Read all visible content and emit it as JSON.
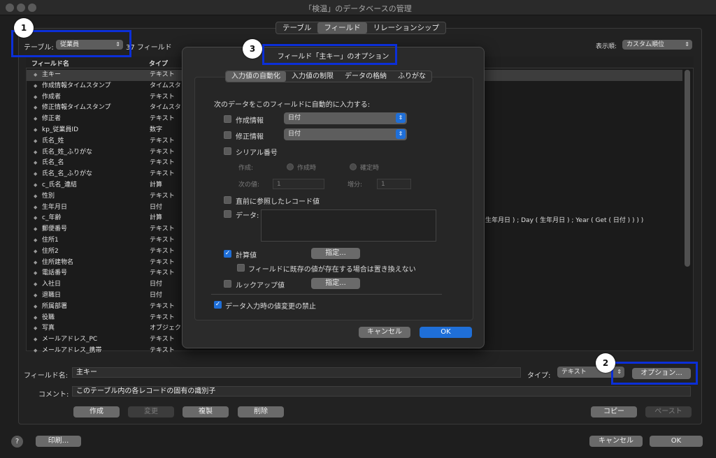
{
  "window": {
    "title": "「検温」のデータベースの管理"
  },
  "main_tabs": [
    {
      "label": "テーブル"
    },
    {
      "label": "フィールド"
    },
    {
      "label": "リレーションシップ"
    }
  ],
  "toolbar": {
    "table_label": "テーブル:",
    "table_value": "従業員",
    "field_count": "37 フィールド",
    "sort_label": "表示順:",
    "sort_value": "カスタム順位"
  },
  "columns": {
    "name": "フィールド名",
    "type": "タイプ"
  },
  "fields": [
    {
      "name": "主キー",
      "type": "テキスト"
    },
    {
      "name": "作成情報タイムスタンプ",
      "type": "タイムスタンプ"
    },
    {
      "name": "作成者",
      "type": "テキスト"
    },
    {
      "name": "修正情報タイムスタンプ",
      "type": "タイムスタンプ"
    },
    {
      "name": "修正者",
      "type": "テキスト"
    },
    {
      "name": "kp_従業員ID",
      "type": "数字"
    },
    {
      "name": "氏名_姓",
      "type": "テキスト"
    },
    {
      "name": "氏名_姓_ふりがな",
      "type": "テキスト"
    },
    {
      "name": "氏名_名",
      "type": "テキスト"
    },
    {
      "name": "氏名_名_ふりがな",
      "type": "テキスト"
    },
    {
      "name": "c_氏名_連結",
      "type": "計算"
    },
    {
      "name": "性別",
      "type": "テキスト"
    },
    {
      "name": "生年月日",
      "type": "日付"
    },
    {
      "name": "c_年齢",
      "type": "計算"
    },
    {
      "name": "郵便番号",
      "type": "テキスト"
    },
    {
      "name": "住所1",
      "type": "テキスト"
    },
    {
      "name": "住所2",
      "type": "テキスト"
    },
    {
      "name": "住所建物名",
      "type": "テキスト"
    },
    {
      "name": "電話番号",
      "type": "テキスト"
    },
    {
      "name": "入社日",
      "type": "日付"
    },
    {
      "name": "退職日",
      "type": "日付"
    },
    {
      "name": "所属部署",
      "type": "テキスト"
    },
    {
      "name": "役職",
      "type": "テキスト"
    },
    {
      "name": "写真",
      "type": "オブジェクト"
    },
    {
      "name": "メールアドレス_PC",
      "type": "テキスト"
    },
    {
      "name": "メールアドレス_携帯",
      "type": "テキスト"
    }
  ],
  "formula_fragment": "生年月日 ) ; Day ( 生年月日 ) ; Year ( Get ( 日付 ) ) ) )",
  "editor": {
    "name_label": "フィールド名:",
    "name_value": "主キー",
    "type_label": "タイプ:",
    "type_value": "テキスト",
    "options_button": "オプション...",
    "comment_label": "コメント:",
    "comment_value": "このテーブル内の各レコードの固有の識別子"
  },
  "buttons": {
    "create": "作成",
    "change": "変更",
    "duplicate": "複製",
    "delete": "削除",
    "copy": "コピー",
    "paste": "ペースト",
    "print": "印刷...",
    "cancel": "キャンセル",
    "ok": "OK",
    "help": "?"
  },
  "dialog": {
    "title": "フィールド「主キー」のオプション",
    "tabs": [
      {
        "label": "入力値の自動化"
      },
      {
        "label": "入力値の制限"
      },
      {
        "label": "データの格納"
      },
      {
        "label": "ふりがな"
      }
    ],
    "heading": "次のデータをこのフィールドに自動的に入力する:",
    "creation_label": "作成情報",
    "creation_value": "日付",
    "modification_label": "修正情報",
    "modification_value": "日付",
    "serial_label": "シリアル番号",
    "generate_label": "作成:",
    "on_creation": "作成時",
    "on_commit": "確定時",
    "next_value_label": "次の値:",
    "next_value": "1",
    "increment_label": "増分:",
    "increment": "1",
    "last_visited_label": "直前に参照したレコード値",
    "data_label": "データ:",
    "calculated_label": "計算値",
    "specify": "指定...",
    "replace_label": "フィールドに既存の値が存在する場合は置き換えない",
    "lookup_label": "ルックアップ値",
    "prohibit_label": "データ入力時の値変更の禁止",
    "cancel": "キャンセル",
    "ok": "OK"
  },
  "callouts": [
    "1",
    "2",
    "3"
  ]
}
